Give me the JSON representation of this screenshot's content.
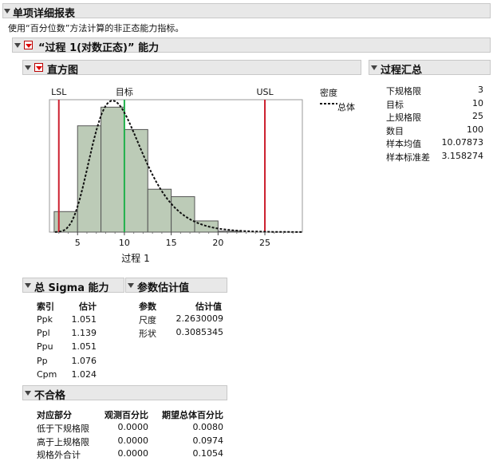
{
  "report": {
    "title": "单项详细报表",
    "note": "使用“百分位数”方法计算的非正态能力指标。"
  },
  "process": {
    "title": "“过程 1(对数正态)” 能力"
  },
  "histogram": {
    "title": "直方图",
    "legend_title": "密度",
    "legend_item": "总体",
    "lsl_label": "LSL",
    "target_label": "目标",
    "usl_label": "USL"
  },
  "chart_data": {
    "type": "bar",
    "xlabel": "过程 1",
    "xlim": [
      2,
      29
    ],
    "xticks": [
      5,
      10,
      15,
      20,
      25
    ],
    "bins": [
      {
        "from": 2.5,
        "to": 5,
        "value": 0.022
      },
      {
        "from": 5,
        "to": 7.5,
        "value": 0.114
      },
      {
        "from": 7.5,
        "to": 10,
        "value": 0.134
      },
      {
        "from": 10,
        "to": 12.5,
        "value": 0.11
      },
      {
        "from": 12.5,
        "to": 15,
        "value": 0.046
      },
      {
        "from": 15,
        "to": 17.5,
        "value": 0.038
      },
      {
        "from": 17.5,
        "to": 20,
        "value": 0.012
      },
      {
        "from": 20,
        "to": 22.5,
        "value": 0.001
      }
    ],
    "density_curve": {
      "name": "总体",
      "distribution": "lognormal",
      "scale": 2.2630009,
      "shape": 0.3085345
    },
    "reference_lines": [
      {
        "name": "LSL",
        "x": 3,
        "color": "#cc1f2e"
      },
      {
        "name": "目标",
        "x": 10,
        "color": "#22b14c"
      },
      {
        "name": "USL",
        "x": 25,
        "color": "#cc1f2e"
      }
    ],
    "bar_color": "#bccbb7",
    "ymax": 0.142
  },
  "summary": {
    "title": "过程汇总",
    "rows": [
      {
        "label": "下规格限",
        "value": "3"
      },
      {
        "label": "目标",
        "value": "10"
      },
      {
        "label": "上规格限",
        "value": "25"
      },
      {
        "label": "数目",
        "value": "100"
      },
      {
        "label": "样本均值",
        "value": "10.07873"
      },
      {
        "label": "样本标准差",
        "value": "3.158274"
      }
    ]
  },
  "sigma": {
    "title": "总 Sigma 能力",
    "col1": "索引",
    "col2": "估计",
    "rows": [
      {
        "label": "Ppk",
        "value": "1.051"
      },
      {
        "label": "Ppl",
        "value": "1.139"
      },
      {
        "label": "Ppu",
        "value": "1.051"
      },
      {
        "label": "Pp",
        "value": "1.076"
      },
      {
        "label": "Cpm",
        "value": "1.024"
      }
    ]
  },
  "params": {
    "title": "参数估计值",
    "col1": "参数",
    "col2": "估计值",
    "rows": [
      {
        "label": "尺度",
        "value": "2.2630009"
      },
      {
        "label": "形状",
        "value": "0.3085345"
      }
    ]
  },
  "nonconf": {
    "title": "不合格",
    "col1": "对应部分",
    "col2": "观测百分比",
    "col3": "期望总体百分比",
    "rows": [
      {
        "label": "低于下规格限",
        "obs": "0.0000",
        "exp": "0.0080"
      },
      {
        "label": "高于上规格限",
        "obs": "0.0000",
        "exp": "0.0974"
      },
      {
        "label": "规格外合计",
        "obs": "0.0000",
        "exp": "0.1054"
      }
    ]
  }
}
